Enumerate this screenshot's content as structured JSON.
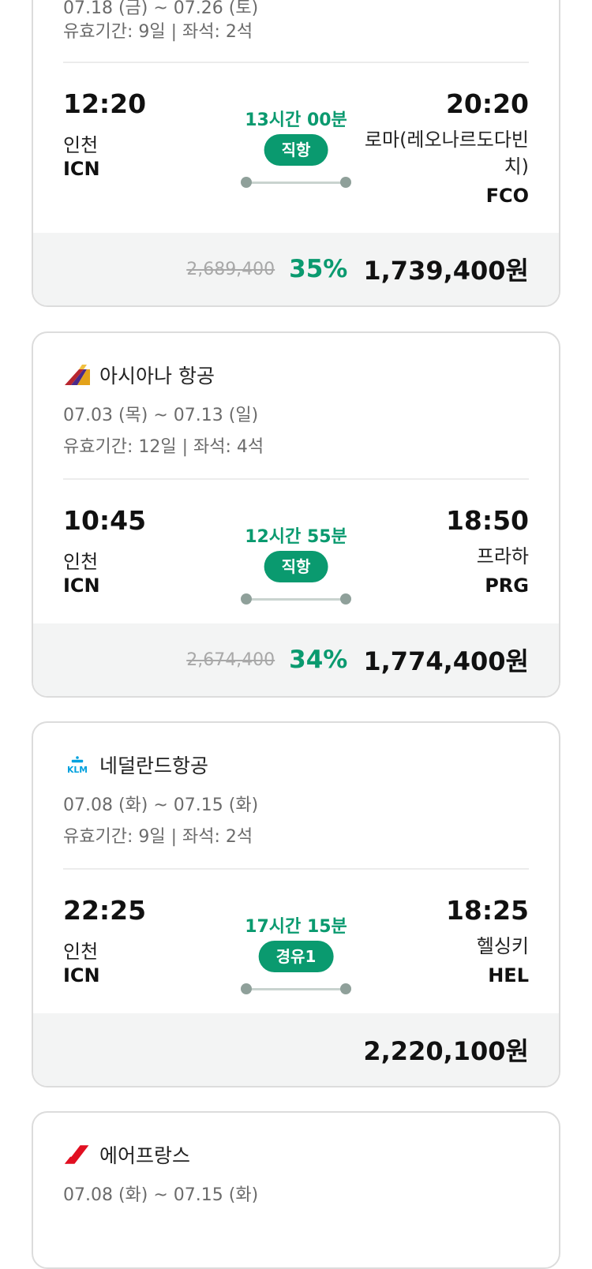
{
  "cards": [
    {
      "airline": "",
      "dates": "07.18 (금) ~ 07.26 (토)",
      "validity": "유효기간: 9일 | 좌석: 2석",
      "dep_time": "12:20",
      "dep_city": "인천",
      "dep_code": "ICN",
      "duration": "13시간 00분",
      "stop_badge": "직항",
      "arr_time": "20:20",
      "arr_city": "로마(레오나르도다빈치)",
      "arr_code": "FCO",
      "original_price": "2,689,400",
      "discount": "35%",
      "price": "1,739,400원"
    },
    {
      "airline": "아시아나 항공",
      "dates": "07.03 (목) ~ 07.13 (일)",
      "validity": "유효기간: 12일 | 좌석: 4석",
      "dep_time": "10:45",
      "dep_city": "인천",
      "dep_code": "ICN",
      "duration": "12시간 55분",
      "stop_badge": "직항",
      "arr_time": "18:50",
      "arr_city": "프라하",
      "arr_code": "PRG",
      "original_price": "2,674,400",
      "discount": "34%",
      "price": "1,774,400원"
    },
    {
      "airline": "네덜란드항공",
      "logo_text": "KLM",
      "dates": "07.08 (화) ~ 07.15 (화)",
      "validity": "유효기간: 9일 | 좌석: 2석",
      "dep_time": "22:25",
      "dep_city": "인천",
      "dep_code": "ICN",
      "duration": "17시간 15분",
      "stop_badge": "경유1",
      "arr_time": "18:25",
      "arr_city": "헬싱키",
      "arr_code": "HEL",
      "price": "2,220,100원"
    },
    {
      "airline": "에어프랑스",
      "dates": "07.08 (화) ~ 07.15 (화)"
    }
  ],
  "colors": {
    "accent_green": "#0a9a6f",
    "route_dot": "#8fa09a",
    "strike_gray": "#a8a8a8"
  },
  "icons": [
    "asiana-logo-icon",
    "klm-logo-icon",
    "air-france-logo-icon"
  ]
}
